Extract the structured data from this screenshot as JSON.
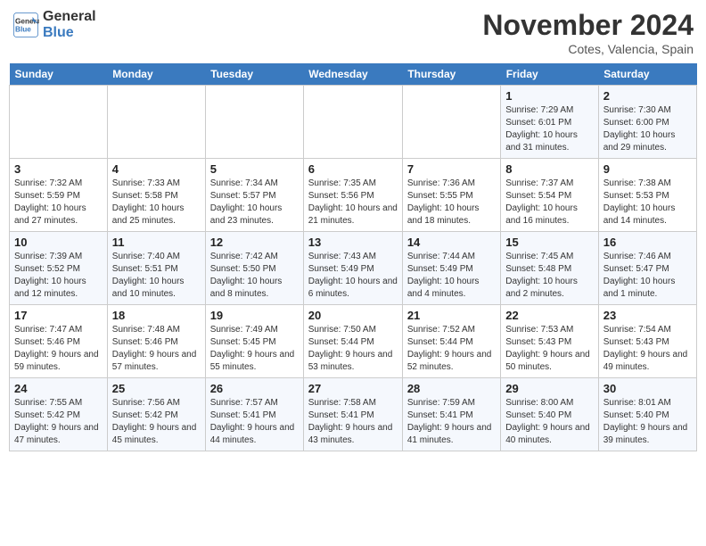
{
  "logo": {
    "line1": "General",
    "line2": "Blue"
  },
  "title": "November 2024",
  "location": "Cotes, Valencia, Spain",
  "days_of_week": [
    "Sunday",
    "Monday",
    "Tuesday",
    "Wednesday",
    "Thursday",
    "Friday",
    "Saturday"
  ],
  "weeks": [
    [
      {
        "num": "",
        "info": ""
      },
      {
        "num": "",
        "info": ""
      },
      {
        "num": "",
        "info": ""
      },
      {
        "num": "",
        "info": ""
      },
      {
        "num": "",
        "info": ""
      },
      {
        "num": "1",
        "info": "Sunrise: 7:29 AM\nSunset: 6:01 PM\nDaylight: 10 hours and 31 minutes."
      },
      {
        "num": "2",
        "info": "Sunrise: 7:30 AM\nSunset: 6:00 PM\nDaylight: 10 hours and 29 minutes."
      }
    ],
    [
      {
        "num": "3",
        "info": "Sunrise: 7:32 AM\nSunset: 5:59 PM\nDaylight: 10 hours and 27 minutes."
      },
      {
        "num": "4",
        "info": "Sunrise: 7:33 AM\nSunset: 5:58 PM\nDaylight: 10 hours and 25 minutes."
      },
      {
        "num": "5",
        "info": "Sunrise: 7:34 AM\nSunset: 5:57 PM\nDaylight: 10 hours and 23 minutes."
      },
      {
        "num": "6",
        "info": "Sunrise: 7:35 AM\nSunset: 5:56 PM\nDaylight: 10 hours and 21 minutes."
      },
      {
        "num": "7",
        "info": "Sunrise: 7:36 AM\nSunset: 5:55 PM\nDaylight: 10 hours and 18 minutes."
      },
      {
        "num": "8",
        "info": "Sunrise: 7:37 AM\nSunset: 5:54 PM\nDaylight: 10 hours and 16 minutes."
      },
      {
        "num": "9",
        "info": "Sunrise: 7:38 AM\nSunset: 5:53 PM\nDaylight: 10 hours and 14 minutes."
      }
    ],
    [
      {
        "num": "10",
        "info": "Sunrise: 7:39 AM\nSunset: 5:52 PM\nDaylight: 10 hours and 12 minutes."
      },
      {
        "num": "11",
        "info": "Sunrise: 7:40 AM\nSunset: 5:51 PM\nDaylight: 10 hours and 10 minutes."
      },
      {
        "num": "12",
        "info": "Sunrise: 7:42 AM\nSunset: 5:50 PM\nDaylight: 10 hours and 8 minutes."
      },
      {
        "num": "13",
        "info": "Sunrise: 7:43 AM\nSunset: 5:49 PM\nDaylight: 10 hours and 6 minutes."
      },
      {
        "num": "14",
        "info": "Sunrise: 7:44 AM\nSunset: 5:49 PM\nDaylight: 10 hours and 4 minutes."
      },
      {
        "num": "15",
        "info": "Sunrise: 7:45 AM\nSunset: 5:48 PM\nDaylight: 10 hours and 2 minutes."
      },
      {
        "num": "16",
        "info": "Sunrise: 7:46 AM\nSunset: 5:47 PM\nDaylight: 10 hours and 1 minute."
      }
    ],
    [
      {
        "num": "17",
        "info": "Sunrise: 7:47 AM\nSunset: 5:46 PM\nDaylight: 9 hours and 59 minutes."
      },
      {
        "num": "18",
        "info": "Sunrise: 7:48 AM\nSunset: 5:46 PM\nDaylight: 9 hours and 57 minutes."
      },
      {
        "num": "19",
        "info": "Sunrise: 7:49 AM\nSunset: 5:45 PM\nDaylight: 9 hours and 55 minutes."
      },
      {
        "num": "20",
        "info": "Sunrise: 7:50 AM\nSunset: 5:44 PM\nDaylight: 9 hours and 53 minutes."
      },
      {
        "num": "21",
        "info": "Sunrise: 7:52 AM\nSunset: 5:44 PM\nDaylight: 9 hours and 52 minutes."
      },
      {
        "num": "22",
        "info": "Sunrise: 7:53 AM\nSunset: 5:43 PM\nDaylight: 9 hours and 50 minutes."
      },
      {
        "num": "23",
        "info": "Sunrise: 7:54 AM\nSunset: 5:43 PM\nDaylight: 9 hours and 49 minutes."
      }
    ],
    [
      {
        "num": "24",
        "info": "Sunrise: 7:55 AM\nSunset: 5:42 PM\nDaylight: 9 hours and 47 minutes."
      },
      {
        "num": "25",
        "info": "Sunrise: 7:56 AM\nSunset: 5:42 PM\nDaylight: 9 hours and 45 minutes."
      },
      {
        "num": "26",
        "info": "Sunrise: 7:57 AM\nSunset: 5:41 PM\nDaylight: 9 hours and 44 minutes."
      },
      {
        "num": "27",
        "info": "Sunrise: 7:58 AM\nSunset: 5:41 PM\nDaylight: 9 hours and 43 minutes."
      },
      {
        "num": "28",
        "info": "Sunrise: 7:59 AM\nSunset: 5:41 PM\nDaylight: 9 hours and 41 minutes."
      },
      {
        "num": "29",
        "info": "Sunrise: 8:00 AM\nSunset: 5:40 PM\nDaylight: 9 hours and 40 minutes."
      },
      {
        "num": "30",
        "info": "Sunrise: 8:01 AM\nSunset: 5:40 PM\nDaylight: 9 hours and 39 minutes."
      }
    ]
  ]
}
